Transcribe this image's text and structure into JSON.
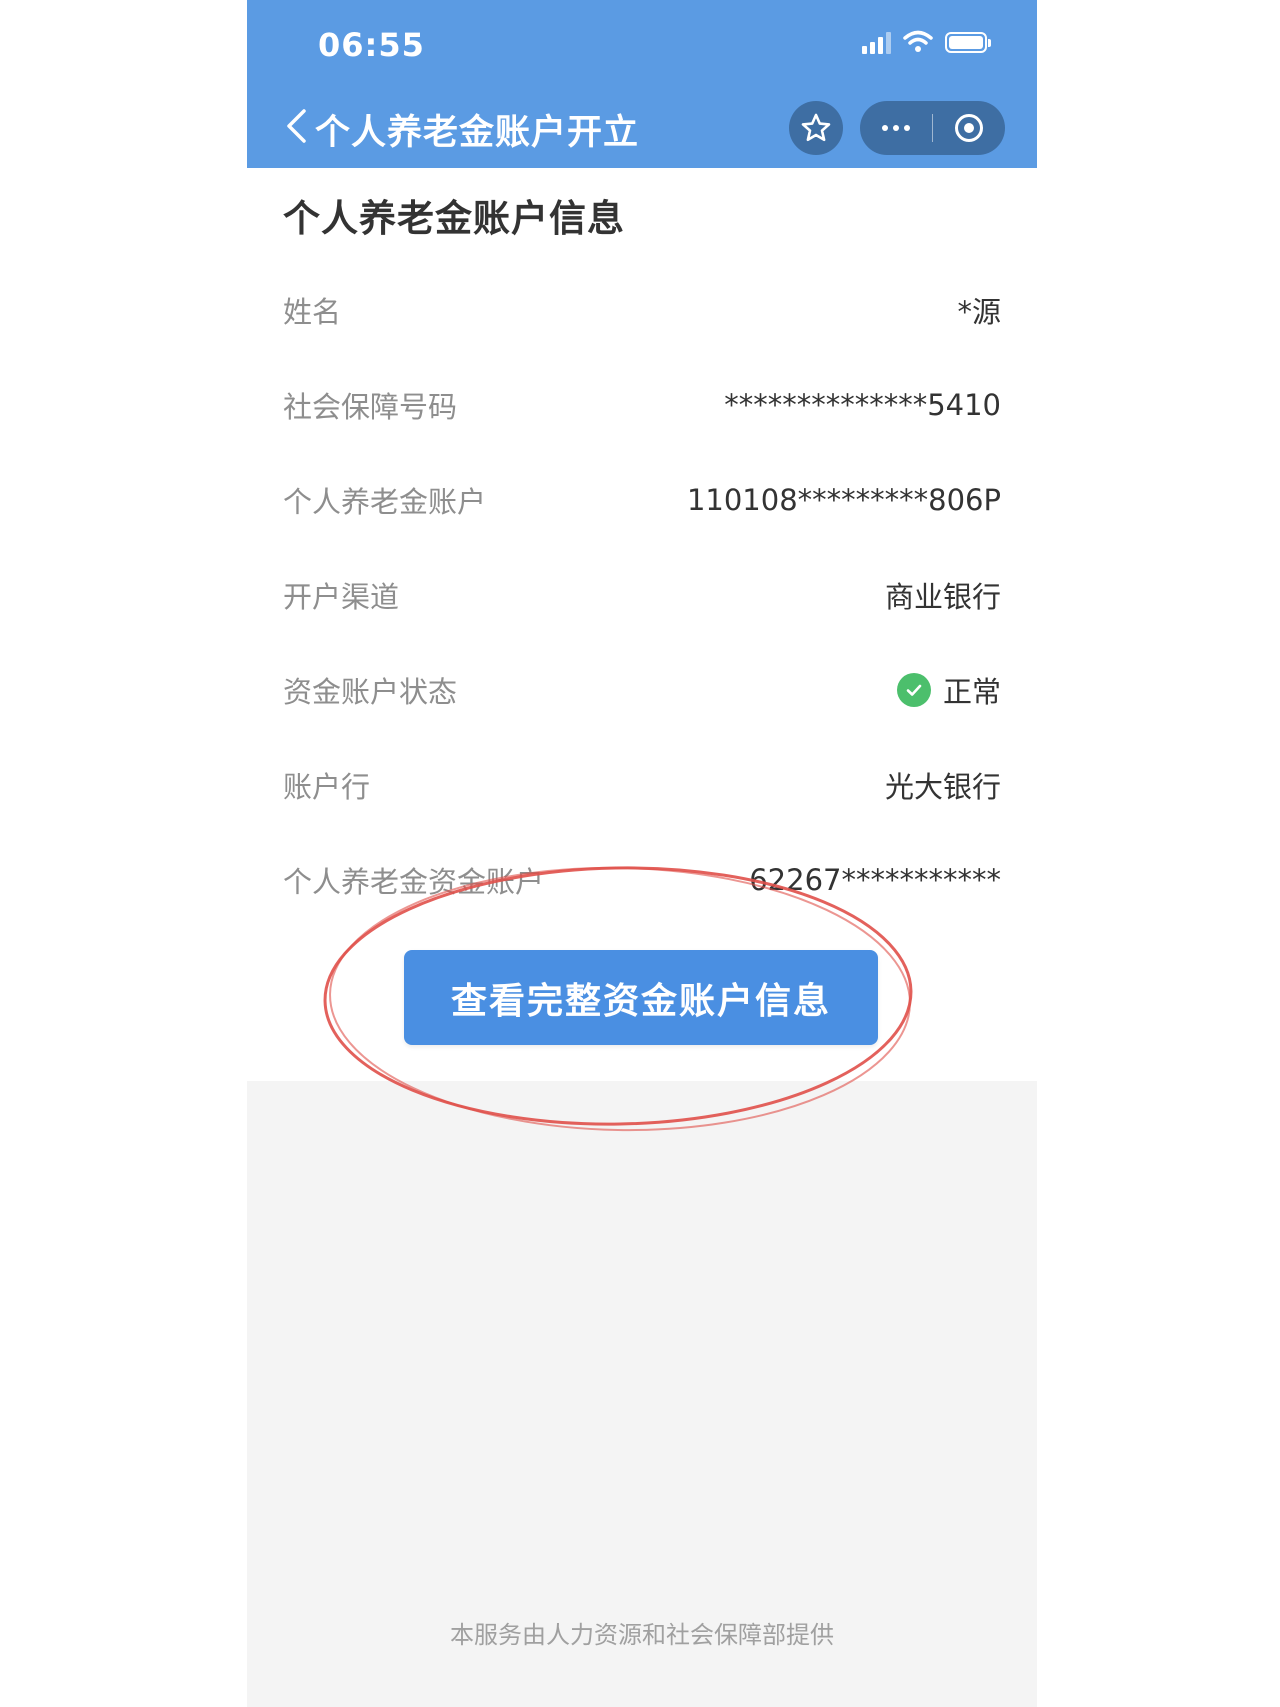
{
  "status_bar": {
    "time": "06:55"
  },
  "nav": {
    "title": "个人养老金账户开立",
    "back_icon": "chevron-left-icon",
    "favorite_icon": "star-icon",
    "more_icon": "more-dots-icon",
    "close_icon": "target-ring-icon"
  },
  "section": {
    "title": "个人养老金账户信息"
  },
  "rows": [
    {
      "label": "姓名",
      "value": "*源"
    },
    {
      "label": "社会保障号码",
      "value": "**************5410"
    },
    {
      "label": "个人养老金账户",
      "value": "110108*********806P"
    },
    {
      "label": "开户渠道",
      "value": "商业银行"
    },
    {
      "label": "资金账户状态",
      "value": "正常",
      "status_icon": "check-circle-icon"
    },
    {
      "label": "账户行",
      "value": "光大银行"
    },
    {
      "label": "个人养老金资金账户",
      "value": "62267***********"
    }
  ],
  "action": {
    "label": "查看完整资金账户信息"
  },
  "footer": {
    "text": "本服务由人力资源和社会保障部提供"
  },
  "colors": {
    "header": "#5b9be3",
    "button": "#4a8fe2",
    "status_ok": "#4cbf6c",
    "annotation": "#e0504a"
  }
}
